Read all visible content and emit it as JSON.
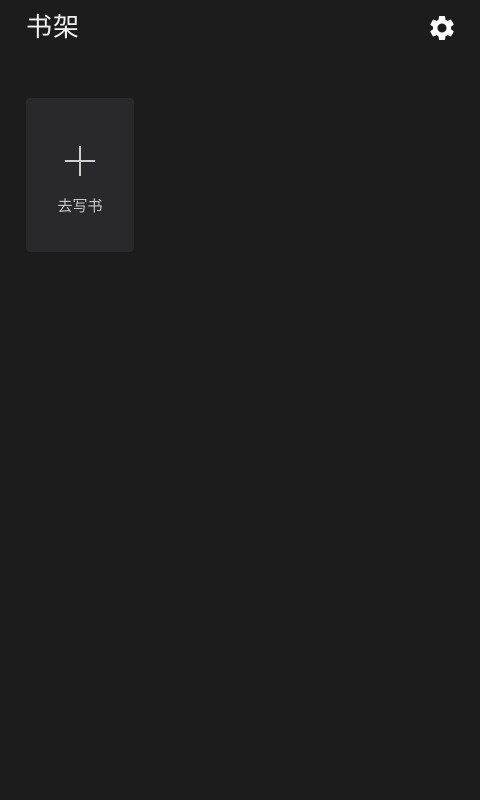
{
  "header": {
    "title": "书架",
    "settings_icon": "gear-icon"
  },
  "shelf": {
    "write_card": {
      "icon": "plus-icon",
      "label": "去写书"
    }
  },
  "colors": {
    "background": "#1c1c1c",
    "card": "#29292b",
    "title_text": "#f2f2f2",
    "label_text": "#c8c8c8"
  }
}
